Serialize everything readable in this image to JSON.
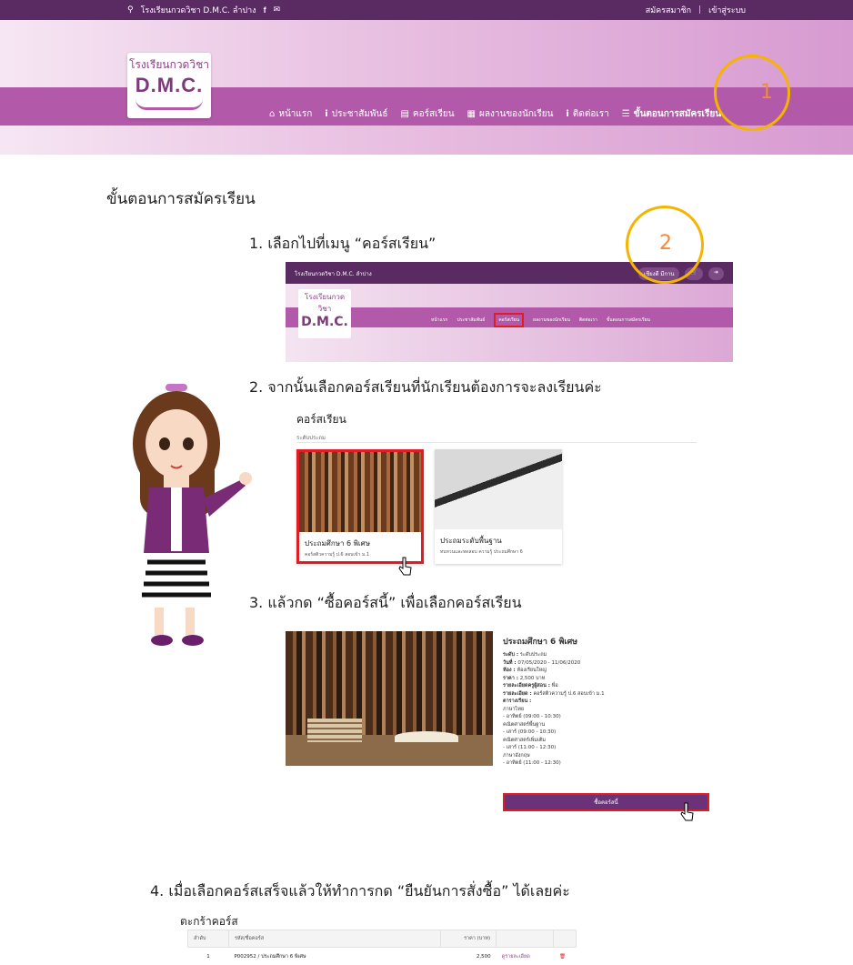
{
  "topbar": {
    "school_name": "โรงเรียนกวดวิชา D.M.C. ลำปาง",
    "register": "สมัครสมาชิก",
    "separator": "|",
    "login": "เข้าสู่ระบบ"
  },
  "logo": {
    "thai": "โรงเรียนกวดวิชา",
    "english": "D.M.C."
  },
  "nav": {
    "items": [
      {
        "label": "หน้าแรก",
        "icon": "home-icon"
      },
      {
        "label": "ประชาสัมพันธ์",
        "icon": "info-icon"
      },
      {
        "label": "คอร์สเรียน",
        "icon": "list-icon"
      },
      {
        "label": "ผลงานของนักเรียน",
        "icon": "newspaper-icon"
      },
      {
        "label": "ติดต่อเรา",
        "icon": "info-icon"
      },
      {
        "label": "ขั้นตอนการสมัครเรียน",
        "icon": "bars-icon"
      }
    ]
  },
  "annotations": {
    "circle1": "1",
    "circle2": "2"
  },
  "page_title": "ขั้นตอนการสมัครเรียน",
  "steps": {
    "s1": "1. เลือกไปที่เมนู “คอร์สเรียน”",
    "s2": "2. จากนั้นเลือกคอร์สเรียนที่นักเรียนต้องการจะลงเรียนค่ะ",
    "s3": "3. แล้วกด “ซื้อคอร์สนี้” เพื่อเลือกคอร์สเรียน",
    "s4": "4. เมื่อเลือกคอร์สเสร็จแล้วให้ทำการกด “ยืนยันการสั่งซื้อ” ได้เลยค่ะ"
  },
  "mini": {
    "school": "โรงเรียนกวดวิชา D.M.C. ลำปาง",
    "user": "เชียงดี มีกาน",
    "logo_th": "โรงเรียนกวดวิชา",
    "logo_en": "D.M.C.",
    "nav": [
      "หน้าแรก",
      "ประชาสัมพันธ์",
      "คอร์สเรียน",
      "ผลงานของนักเรียน",
      "ติดต่อเรา",
      "ขั้นตอนการสมัครเรียน"
    ]
  },
  "courses": {
    "heading": "คอร์สเรียน",
    "subheading": "ระดับประถม",
    "cards": [
      {
        "title": "ประถมศึกษา 6 พิเศษ",
        "desc": "คอร์สติวความรู้ ป.6 สอบเข้า ม.1"
      },
      {
        "title": "ประถมระดับพื้นฐาน",
        "desc": "ทบทวนและทดสอบ ความรู้ ประถมศึกษา 6"
      }
    ]
  },
  "product": {
    "title": "ประถมศึกษา 6 พิเศษ",
    "level_label": "ระดับ :",
    "level": "ระดับประถม",
    "date_label": "วันที่ :",
    "date": "07/05/2020 - 11/06/2020",
    "room_label": "ห้อง :",
    "room": "ห้องเรียนใหญ่",
    "price_label": "ราคา :",
    "price": "2,500 บาท",
    "teacher_label": "รายละเอียดครูผู้สอน :",
    "teacher": "พี่อ",
    "detail_label": "รายละเอียด :",
    "detail": "คอร์สติวความรู้ ป.6 สอบเข้า ม.1",
    "schedule_label": "ตารางเรียน :",
    "schedule": [
      "ภาษาไทย",
      "- อาทิตย์ (09:00 - 10:30)",
      "คณิตศาสตร์พื้นฐาน",
      "- เสาร์ (09:00 - 10:30)",
      "คณิตศาสตร์เพิ่มเติม",
      "- เสาร์ (11:00 - 12:30)",
      "ภาษาอังกฤษ",
      "- อาทิตย์ (11:00 - 12:30)"
    ],
    "buy_button": "ซื้อคอร์สนี้"
  },
  "cart": {
    "heading": "ตะกร้าคอร์ส",
    "columns": [
      "ลำดับ",
      "รหัส/ชื่อคอร์ส",
      "ราคา (บาท)",
      "",
      ""
    ],
    "rows": [
      {
        "no": "1",
        "name": "P002952 / ประถมศึกษา 6 พิเศษ",
        "price": "2,500",
        "action": "ดูรายละเอียด"
      }
    ]
  }
}
